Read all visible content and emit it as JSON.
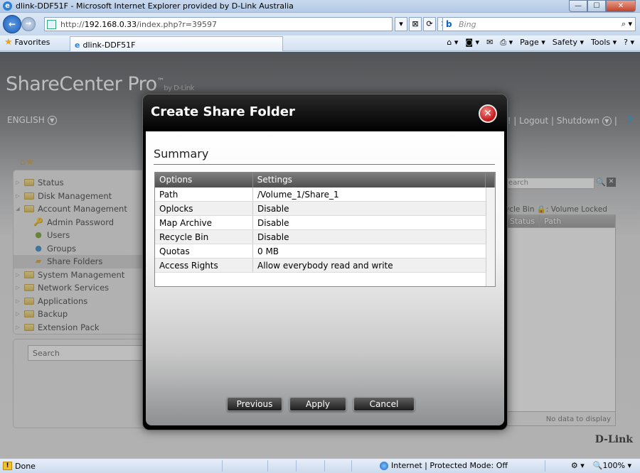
{
  "browser": {
    "title": "dlink-DDF51F - Microsoft Internet Explorer provided by D-Link Australia",
    "url_prefix": "http://",
    "url_host": "192.168.0.33",
    "url_path": "/index.php?r=39597",
    "search_engine": "Bing",
    "tab_title": "dlink-DDF51F",
    "favorites_label": "Favorites",
    "commands": [
      "Page ▾",
      "Safety ▾",
      "Tools ▾"
    ],
    "status_text": "Done",
    "zone_text": "Internet | Protected Mode: Off",
    "zoom": "100%"
  },
  "app": {
    "brand": "ShareCenter Pro",
    "brand_tm": "™",
    "brand_by": "by D-Link",
    "language": "ENGLISH",
    "top_links_partial": "min! | Logout | Shutdown",
    "footer_logo": "D-Link"
  },
  "tree": {
    "items": [
      {
        "label": "Status",
        "level": 0,
        "icon": "folder-icon",
        "expanded": false
      },
      {
        "label": "Disk Management",
        "level": 0,
        "icon": "folder-icon",
        "expanded": false
      },
      {
        "label": "Account Management",
        "level": 0,
        "icon": "folder-icon",
        "expanded": true
      },
      {
        "label": "Admin Password",
        "level": 1,
        "icon": "key-icon"
      },
      {
        "label": "Users",
        "level": 1,
        "icon": "user-icon"
      },
      {
        "label": "Groups",
        "level": 1,
        "icon": "group-icon"
      },
      {
        "label": "Share Folders",
        "level": 1,
        "icon": "share-folder-icon",
        "selected": true
      },
      {
        "label": "System Management",
        "level": 0,
        "icon": "folder-icon",
        "expanded": false
      },
      {
        "label": "Network Services",
        "level": 0,
        "icon": "folder-icon",
        "expanded": false
      },
      {
        "label": "Applications",
        "level": 0,
        "icon": "folder-icon",
        "expanded": false
      },
      {
        "label": "Backup",
        "level": 0,
        "icon": "folder-icon",
        "expanded": false
      },
      {
        "label": "Extension Pack",
        "level": 0,
        "icon": "folder-icon",
        "expanded": false
      }
    ]
  },
  "left_search": {
    "placeholder": "Search"
  },
  "right_panel": {
    "search_partial": "earch",
    "legend_partial": "ycle Bin",
    "legend_locked": ": Volume Locked",
    "columns": [
      "Status",
      "Path"
    ],
    "empty_text": "No data to display"
  },
  "modal": {
    "title": "Create Share Folder",
    "section_title": "Summary",
    "columns": [
      "Options",
      "Settings"
    ],
    "rows": [
      {
        "option": "Path",
        "setting": "/Volume_1/Share_1"
      },
      {
        "option": "Oplocks",
        "setting": "Disable"
      },
      {
        "option": "Map Archive",
        "setting": "Disable"
      },
      {
        "option": "Recycle Bin",
        "setting": "Disable"
      },
      {
        "option": "Quotas",
        "setting": "0 MB"
      },
      {
        "option": "Access Rights",
        "setting": "Allow everybody read and write"
      }
    ],
    "buttons": {
      "previous": "Previous",
      "apply": "Apply",
      "cancel": "Cancel"
    }
  }
}
